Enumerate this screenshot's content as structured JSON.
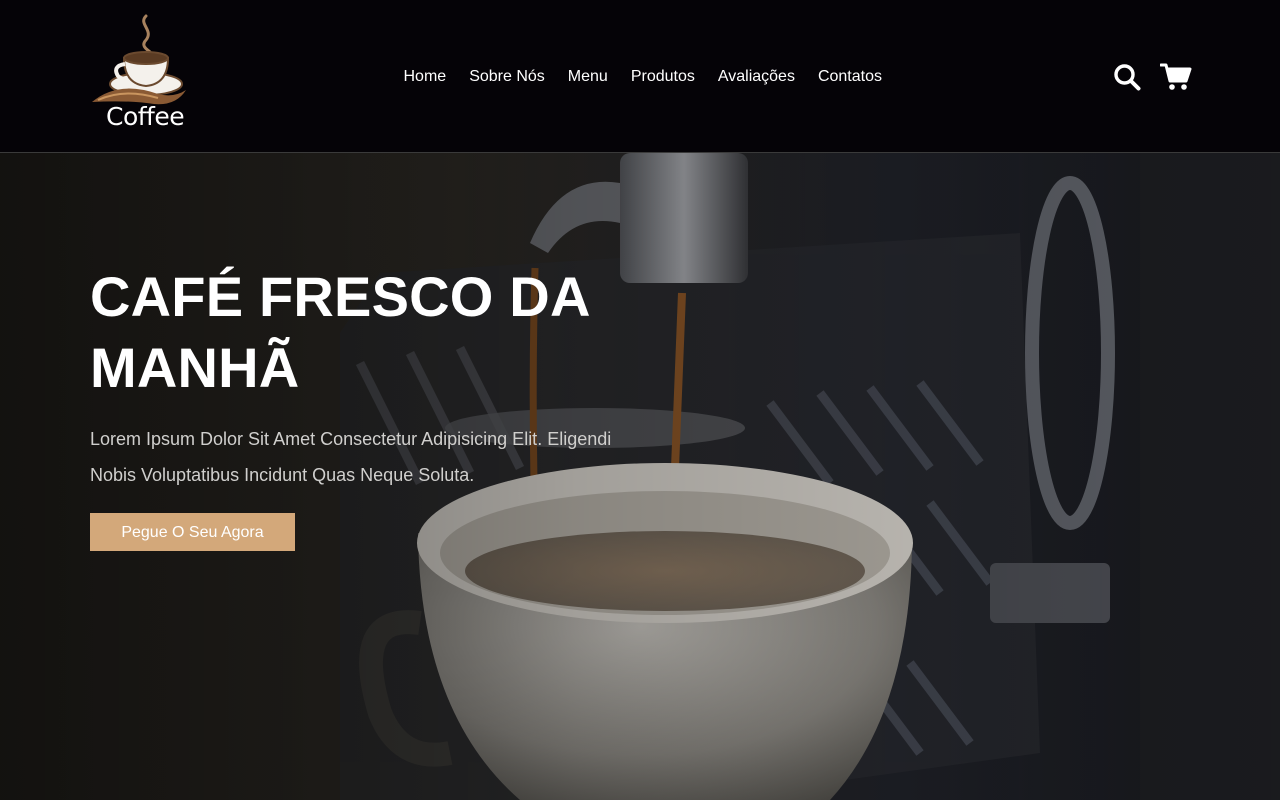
{
  "logo": {
    "text": "Coffee",
    "icon": "coffee-cup-icon"
  },
  "nav": {
    "items": [
      {
        "label": "Home"
      },
      {
        "label": "Sobre Nós"
      },
      {
        "label": "Menu"
      },
      {
        "label": "Produtos"
      },
      {
        "label": "Avaliações"
      },
      {
        "label": "Contatos"
      }
    ]
  },
  "header_icons": {
    "search": "search-icon",
    "cart": "shopping-cart-icon"
  },
  "hero": {
    "title": "CAFÉ FRESCO DA MANHÃ",
    "text": "Lorem Ipsum Dolor Sit Amet Consectetur Adipisicing Elit. Eligendi Nobis Voluptatibus Incidunt Quas Neque Soluta.",
    "button_label": "Pegue O Seu Agora",
    "background": "espresso-machine-pouring-into-white-cup"
  },
  "colors": {
    "header_bg": "#050307",
    "accent": "#d3a87a",
    "text_primary": "#ffffff",
    "text_muted": "#d0cfcd"
  }
}
